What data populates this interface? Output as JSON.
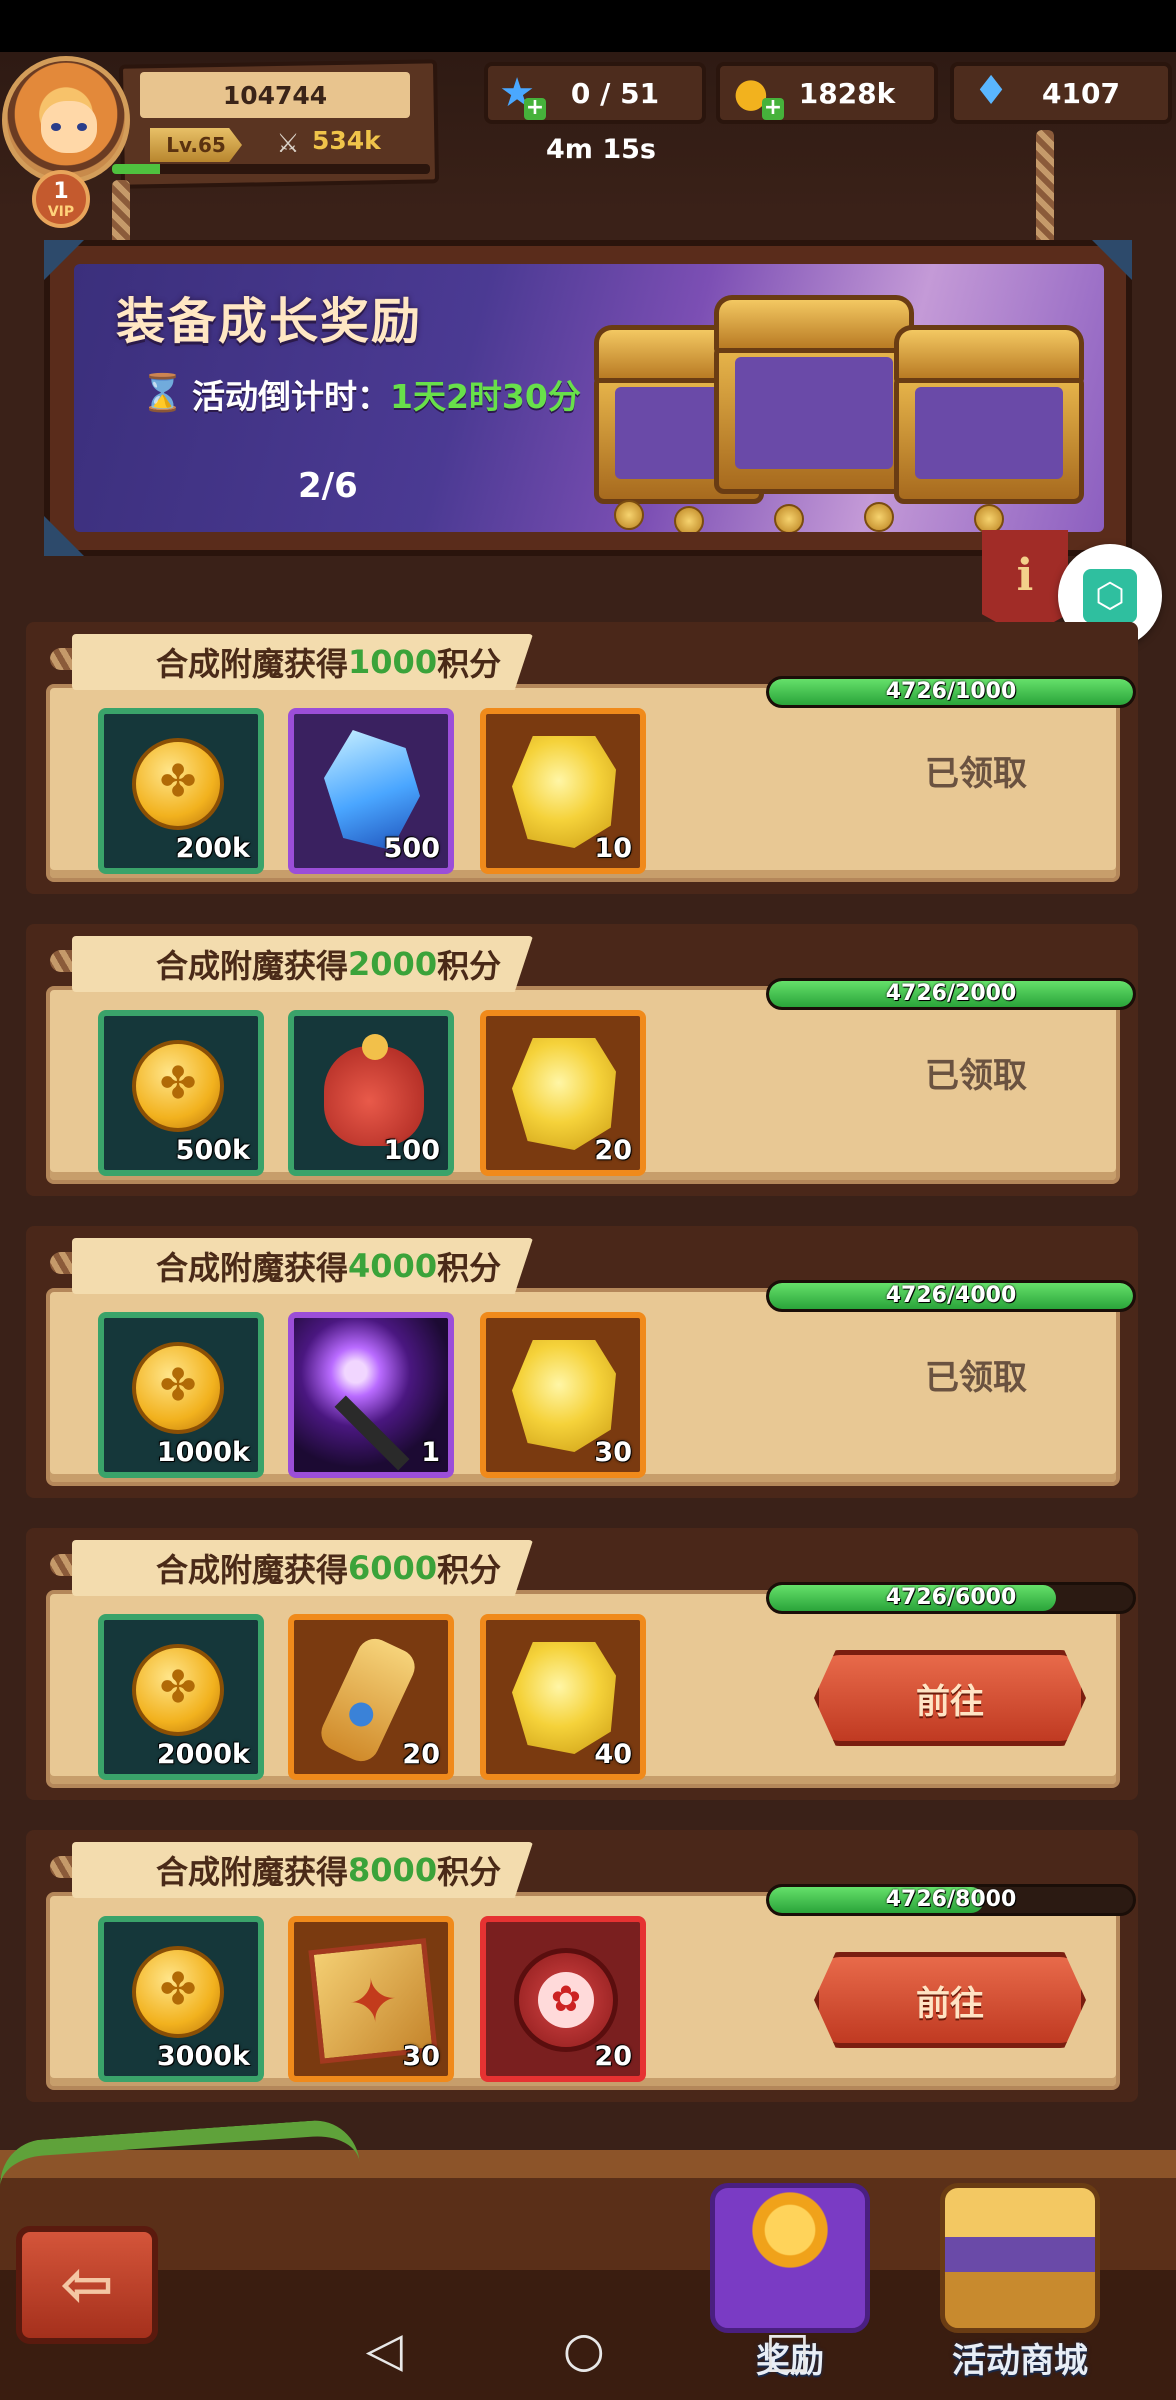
{
  "player": {
    "power": "104744",
    "level": "Lv.65",
    "combat": "534k",
    "vip": "1",
    "vip_label": "VIP",
    "xp_fraction": 0.15
  },
  "resources": {
    "stamina": "0 / 51",
    "stamina_timer": "4m 15s",
    "gold": "1828k",
    "gems": "4107"
  },
  "banner": {
    "title": "装备成长奖励",
    "countdown_label": "活动倒计时：",
    "countdown_value": "1天2时30分",
    "progress": "2/6"
  },
  "tasks": [
    {
      "title_prefix": "合成附魔获得",
      "points": "1000",
      "title_suffix": "积分",
      "progress_text": "4726/1000",
      "progress_fraction": 1.0,
      "status": "已领取",
      "action": "",
      "rewards": [
        {
          "icon": "gold-coin",
          "frame": "green",
          "qty": "200k"
        },
        {
          "icon": "blue-crystal",
          "frame": "purple",
          "qty": "500"
        },
        {
          "icon": "gold-cube",
          "frame": "orange",
          "qty": "10"
        }
      ]
    },
    {
      "title_prefix": "合成附魔获得",
      "points": "2000",
      "title_suffix": "积分",
      "progress_text": "4726/2000",
      "progress_fraction": 1.0,
      "status": "已领取",
      "action": "",
      "rewards": [
        {
          "icon": "gold-coin",
          "frame": "green",
          "qty": "500k"
        },
        {
          "icon": "red-pouch",
          "frame": "green",
          "qty": "100"
        },
        {
          "icon": "gold-cube",
          "frame": "orange",
          "qty": "20"
        }
      ]
    },
    {
      "title_prefix": "合成附魔获得",
      "points": "4000",
      "title_suffix": "积分",
      "progress_text": "4726/4000",
      "progress_fraction": 1.0,
      "status": "已领取",
      "action": "",
      "rewards": [
        {
          "icon": "gold-coin",
          "frame": "green",
          "qty": "1000k"
        },
        {
          "icon": "lightning-staff",
          "frame": "purple",
          "qty": "1"
        },
        {
          "icon": "gold-cube",
          "frame": "orange",
          "qty": "30"
        }
      ]
    },
    {
      "title_prefix": "合成附魔获得",
      "points": "6000",
      "title_suffix": "积分",
      "progress_text": "4726/6000",
      "progress_fraction": 0.7877,
      "status": "",
      "action": "前往",
      "rewards": [
        {
          "icon": "gold-coin",
          "frame": "green",
          "qty": "2000k"
        },
        {
          "icon": "golden-scroll",
          "frame": "orange",
          "qty": "20"
        },
        {
          "icon": "gold-cube",
          "frame": "orange",
          "qty": "40"
        }
      ]
    },
    {
      "title_prefix": "合成附魔获得",
      "points": "8000",
      "title_suffix": "积分",
      "progress_text": "4726/8000",
      "progress_fraction": 0.5908,
      "status": "",
      "action": "前往",
      "rewards": [
        {
          "icon": "gold-coin",
          "frame": "green",
          "qty": "3000k"
        },
        {
          "icon": "spell-book",
          "frame": "orange",
          "qty": "30"
        },
        {
          "icon": "paw-token",
          "frame": "red",
          "qty": "20"
        }
      ]
    }
  ],
  "bottom_tabs": {
    "rewards": "奖励",
    "shop": "活动商城"
  },
  "colors": {
    "points_green": "#3ba33a",
    "progress_green": "#2aa43a",
    "countdown_green": "#68e04a",
    "go_button": "#c03a22"
  }
}
